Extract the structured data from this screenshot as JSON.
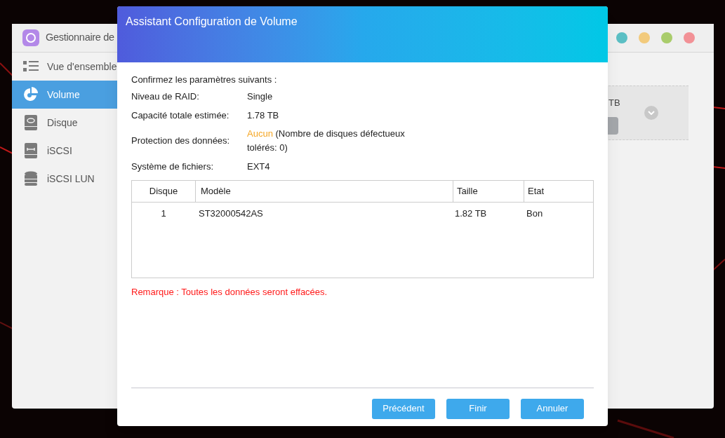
{
  "app_window": {
    "title": "Gestionnaire de",
    "window_buttons": [
      {
        "color": "#5bbfc4"
      },
      {
        "color": "#f2ca7c"
      },
      {
        "color": "#a9cc6b"
      },
      {
        "color": "#f29196"
      }
    ],
    "sidebar": {
      "items": [
        {
          "label": "Vue d'ensemble",
          "kind": "overview",
          "selected": false
        },
        {
          "label": "Volume",
          "kind": "volume",
          "selected": true
        },
        {
          "label": "Disque",
          "kind": "disk",
          "selected": false
        },
        {
          "label": "iSCSI",
          "kind": "iscsi",
          "selected": false
        },
        {
          "label": "iSCSI LUN",
          "kind": "lun",
          "selected": false
        }
      ]
    },
    "volume_card": {
      "size": "TB"
    }
  },
  "dialog": {
    "title": "Assistant Configuration de Volume",
    "intro": "Confirmez les paramètres suivants :",
    "settings": [
      {
        "label": "Niveau de RAID:",
        "value": "Single"
      },
      {
        "label": "Capacité totale estimée:",
        "value": "1.78 TB"
      },
      {
        "label": "Protection des données:",
        "value": "Aucun",
        "note": "(Nombre de disques défectueux tolérés: 0)"
      },
      {
        "label": "Système de fichiers:",
        "value": "EXT4"
      }
    ],
    "table": {
      "columns": [
        "Disque",
        "Modèle",
        "Taille",
        "Etat"
      ],
      "rows": [
        [
          "1",
          "ST32000542AS",
          "1.82 TB",
          "Bon"
        ]
      ]
    },
    "warning": "Remarque : Toutes les données seront effacées.",
    "buttons": [
      "Précédent",
      "Finir",
      "Annuler"
    ]
  }
}
